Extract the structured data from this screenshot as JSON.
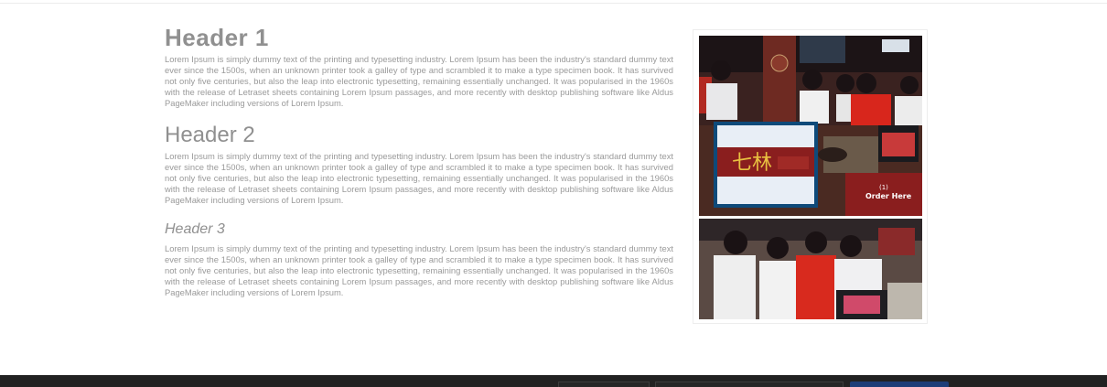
{
  "sections": [
    {
      "heading": "Header 1",
      "body": "Lorem Ipsum is simply dummy text of the printing and typesetting industry. Lorem Ipsum has been the industry's standard dummy text ever since the 1500s, when an unknown printer took a galley of type and scrambled it to make a type specimen book. It has survived not only five centuries, but also the leap into electronic typesetting, remaining essentially unchanged. It was popularised in the 1960s with the release of Letraset sheets containing Lorem Ipsum passages, and more recently with desktop publishing software like Aldus PageMaker including versions of Lorem Ipsum."
    },
    {
      "heading": "Header 2",
      "body": "Lorem Ipsum is simply dummy text of the printing and typesetting industry. Lorem Ipsum has been the industry's standard dummy text ever since the 1500s, when an unknown printer took a galley of type and scrambled it to make a type specimen book. It has survived not only five centuries, but also the leap into electronic typesetting, remaining essentially unchanged. It was popularised in the 1960s with the release of Letraset sheets containing Lorem Ipsum passages, and more recently with desktop publishing software like Aldus PageMaker including versions of Lorem Ipsum."
    },
    {
      "heading": "Header 3",
      "body": "Lorem Ipsum is simply dummy text of the printing and typesetting industry. Lorem Ipsum has been the industry's standard dummy text ever since the 1500s, when an unknown printer took a galley of type and scrambled it to make a type specimen book. It has survived not only five centuries, but also the leap into electronic typesetting, remaining essentially unchanged. It was popularised in the 1960s with the release of Letraset sheets containing Lorem Ipsum passages, and more recently with desktop publishing software like Aldus PageMaker including versions of Lorem Ipsum."
    }
  ],
  "photo": {
    "sign_text": "Order Here",
    "sign_number": "(1)"
  },
  "colors": {
    "heading": "#909090",
    "body_text": "#9a9a9a",
    "footer_bg": "#222222",
    "footer_button": "#1d3e78"
  }
}
